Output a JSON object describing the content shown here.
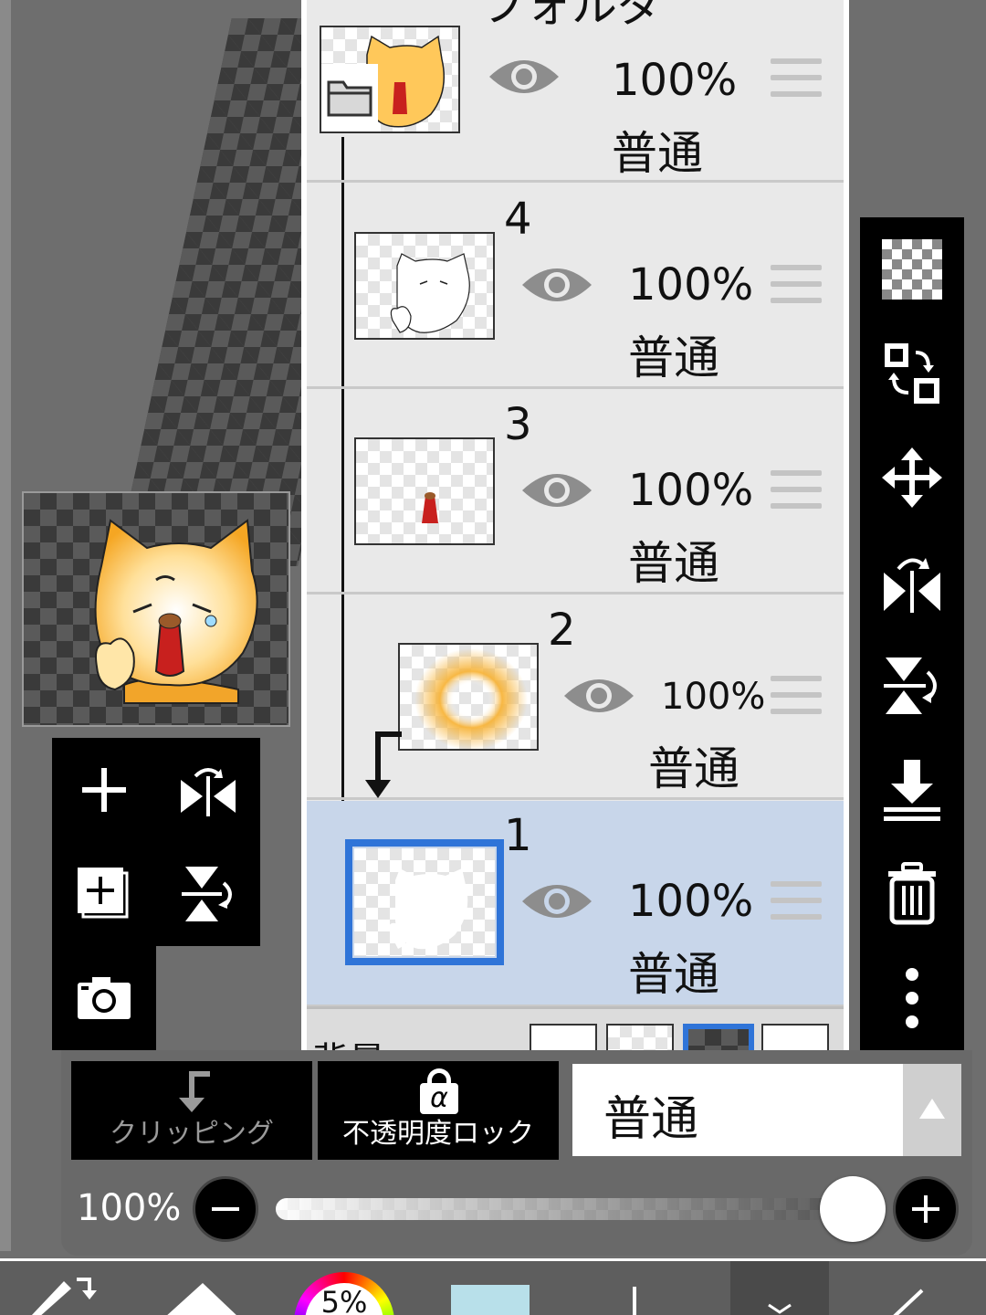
{
  "colors": {
    "selection": "#2f74d8",
    "selected_row": "#c8d6ea",
    "panel_bg": "#e9e9e9"
  },
  "layers": {
    "folder": {
      "name": "フォルダ",
      "opacity": "100%",
      "blend": "普通"
    },
    "items": [
      {
        "number": "4",
        "opacity": "100%",
        "blend": "普通"
      },
      {
        "number": "3",
        "opacity": "100%",
        "blend": "普通"
      },
      {
        "number": "2",
        "opacity": "100%",
        "blend": "普通"
      },
      {
        "number": "1",
        "opacity": "100%",
        "blend": "普通"
      }
    ],
    "background_label": "背景"
  },
  "controls": {
    "clipping_label": "クリッピング",
    "alpha_lock_label": "不透明度ロック",
    "alpha_symbol": "α",
    "blend_mode": "普通",
    "opacity_label": "100%",
    "opacity_value": 1.0
  },
  "bottom_bar": {
    "brush_size_label": "5%",
    "icons": [
      "brush-swap-icon",
      "eraser-icon",
      "color-wheel-icon",
      "color-swatch-icon",
      "pen-icon",
      "layer-icon",
      "ruler-icon"
    ]
  },
  "right_toolbar": {
    "icons": [
      "transparent-layer-icon",
      "swap-layer-icon",
      "move-icon",
      "flip-horizontal-icon",
      "flip-vertical-icon",
      "merge-down-icon",
      "trash-icon",
      "more-icon"
    ]
  }
}
